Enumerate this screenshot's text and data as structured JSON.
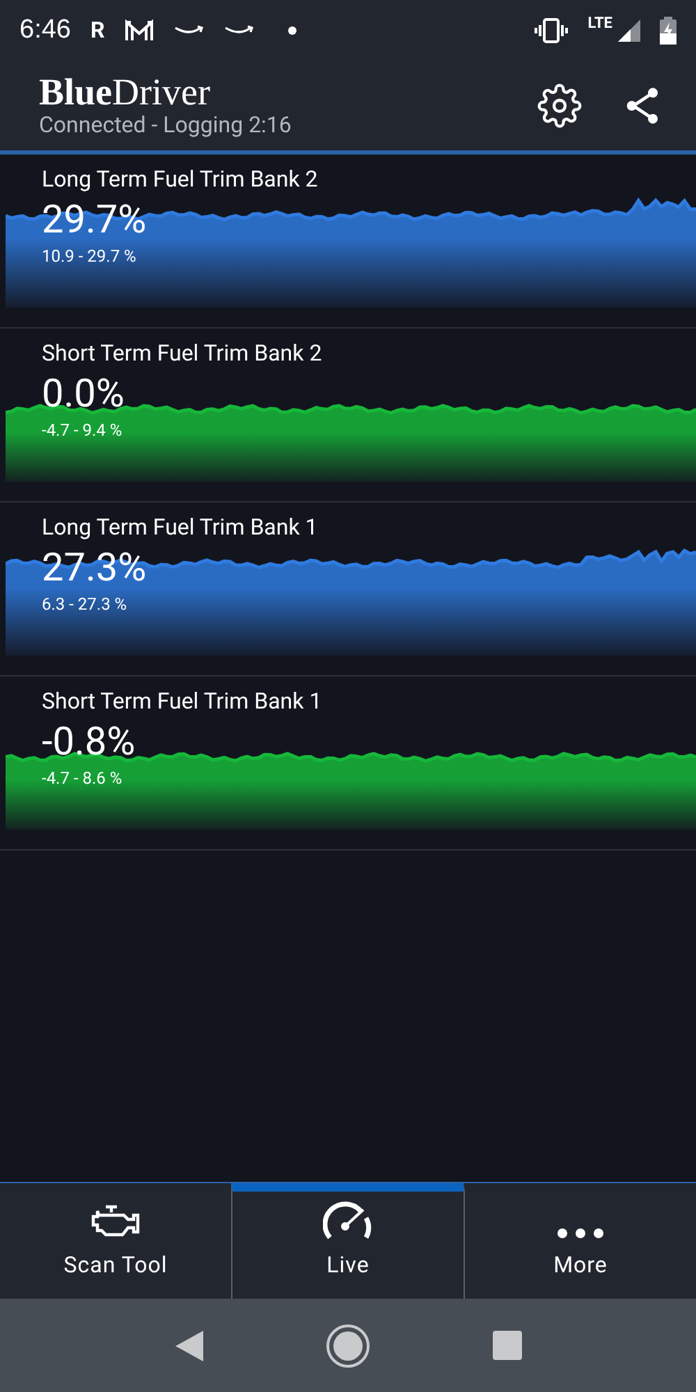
{
  "status_bar": {
    "time": "6:46",
    "app_letter": "R",
    "network": "LTE"
  },
  "header": {
    "title_bold": "Blue",
    "title_rest": "Driver",
    "subtitle": "Connected - Logging 2:16"
  },
  "gauges": [
    {
      "name": "Long Term Fuel Trim Bank 2",
      "value": "29.7%",
      "range": "10.9 - 29.7 %",
      "color": "#2f7be0"
    },
    {
      "name": "Short Term Fuel Trim Bank 2",
      "value": "0.0%",
      "range": "-4.7 - 9.4 %",
      "color": "#16b83a"
    },
    {
      "name": "Long Term Fuel Trim Bank 1",
      "value": "27.3%",
      "range": "6.3 - 27.3 %",
      "color": "#2f7be0"
    },
    {
      "name": "Short Term Fuel Trim Bank 1",
      "value": "-0.8%",
      "range": "-4.7 - 8.6 %",
      "color": "#16b83a"
    }
  ],
  "bottom_nav": [
    {
      "label": "Scan Tool",
      "kind": "engine",
      "selected": false
    },
    {
      "label": "Live",
      "kind": "gauge",
      "selected": true
    },
    {
      "label": "More",
      "kind": "more",
      "selected": false
    }
  ]
}
